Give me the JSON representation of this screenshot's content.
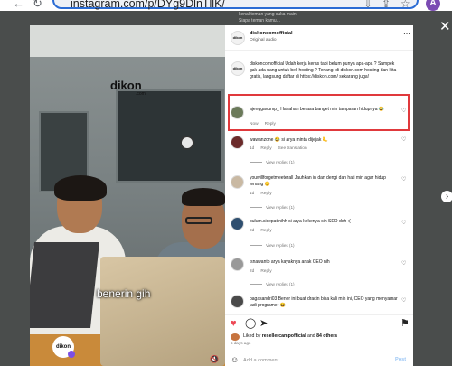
{
  "browser": {
    "url": "instagram.com/p/DYg9DlnTllK/",
    "profile_initial": "A"
  },
  "overlay": {
    "stray_line_1": "kenal teman yang suka main",
    "stray_line_2": "Siapa teman kamu..."
  },
  "video": {
    "logo_text": "dikon",
    "logo_sub": ".com",
    "caption": "benerin gih",
    "watermark": "dikon"
  },
  "post": {
    "username": "diskoncomofficial",
    "audio": "Original audio",
    "caption_user": "diskoncomofficial",
    "caption_text": "Udah kerja keras tapi belum punya apa-apa ? Sampek gak ada uang untuk beli hosting ? Tenang, di diskon.com hosting dan kita gratis, langsung daftar di https://diskon.com/ sekarang juga!"
  },
  "comments": [
    {
      "user": "ajenggavump_",
      "text": "Hahahah berasa banget min tamparan hidupnya 😂",
      "time": "Now",
      "reply_label": "Reply",
      "extra": "",
      "view_replies": ""
    },
    {
      "user": "wawanzone",
      "text": "😂 si arya minta dijejak 🦶",
      "time": "1d",
      "reply_label": "Reply",
      "extra": "See translation",
      "view_replies": "View replies (1)"
    },
    {
      "user": "youwillforgetmeeterall",
      "text": "Jauhkan in dan dengi dan hati min agar hidup tenang 😊",
      "time": "1d",
      "reply_label": "Reply",
      "extra": "",
      "view_replies": "View replies (1)"
    },
    {
      "user": "bukan.sicepat",
      "text": "nihh si arya kekenya sih SEO deh :(",
      "time": "2d",
      "reply_label": "Reply",
      "extra": "",
      "view_replies": "View replies (1)"
    },
    {
      "user": "isnawanto",
      "text": "arya kayaknya anak CEO nih",
      "time": "2d",
      "reply_label": "Reply",
      "extra": "",
      "view_replies": "View replies (1)"
    },
    {
      "user": "bagasandri03",
      "text": "Bener ini buat dracin bisa kali min ini, CEO yang menyamar jadi programer 😂",
      "time": "2d",
      "reply_label": "Reply",
      "extra": "",
      "view_replies": ""
    }
  ],
  "actions": {
    "liked_prefix": "Liked by",
    "liked_user": "resellercampofficial",
    "liked_and": "and",
    "liked_others": "84 others",
    "ago": "5 days ago",
    "add_comment_placeholder": "Add a comment...",
    "post_label": "Post"
  },
  "icons": {
    "back": "arrow-left-icon",
    "reload": "reload-icon",
    "close": "close-icon",
    "next": "chevron-right-icon",
    "heart": "heart-icon",
    "comment": "comment-icon",
    "share": "share-icon",
    "save": "bookmark-icon",
    "emoji": "emoji-icon"
  },
  "colors": {
    "highlight": "#e0393c",
    "link": "#0095f6",
    "liked_heart": "#ed4956"
  }
}
